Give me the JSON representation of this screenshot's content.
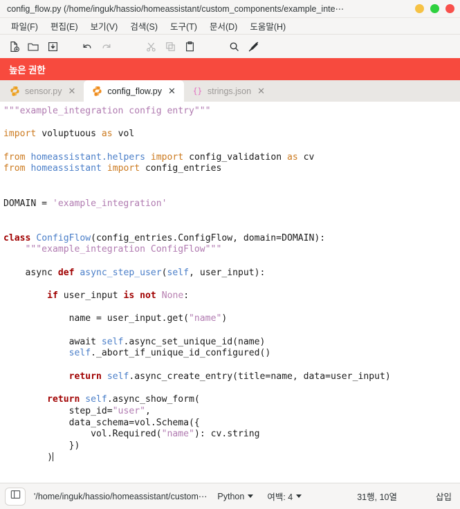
{
  "window": {
    "title": "config_flow.py (/home/inguk/hassio/homeassistant/custom_components/example_inte⋯",
    "buttons": [
      {
        "name": "minimize",
        "color": "#f6c244"
      },
      {
        "name": "maximize",
        "color": "#2fd13f"
      },
      {
        "name": "close",
        "color": "#f8504b"
      }
    ]
  },
  "menu": {
    "items": [
      {
        "label": "파일(F)"
      },
      {
        "label": "편집(E)"
      },
      {
        "label": "보기(V)"
      },
      {
        "label": "검색(S)"
      },
      {
        "label": "도구(T)"
      },
      {
        "label": "문서(D)"
      },
      {
        "label": "도움말(H)"
      }
    ]
  },
  "toolbar": {
    "items": [
      {
        "icon": "new-file-icon",
        "enabled": true
      },
      {
        "icon": "open-folder-icon",
        "enabled": true
      },
      {
        "icon": "save-icon",
        "enabled": true
      },
      {
        "icon": "undo-icon",
        "enabled": true
      },
      {
        "icon": "redo-icon",
        "enabled": false
      },
      {
        "icon": "cut-icon",
        "enabled": false
      },
      {
        "icon": "copy-icon",
        "enabled": false
      },
      {
        "icon": "paste-icon",
        "enabled": true
      },
      {
        "icon": "search-icon",
        "enabled": true
      },
      {
        "icon": "highlight-off-icon",
        "enabled": true
      }
    ]
  },
  "banner": {
    "text": "높은 권한",
    "color": "#f74a3e"
  },
  "tabs": [
    {
      "label": "sensor.py",
      "icon": "python-file-icon",
      "active": false,
      "close": "✕"
    },
    {
      "label": "config_flow.py",
      "icon": "python-file-icon",
      "active": true,
      "close": "✕"
    },
    {
      "label": "strings.json",
      "icon": "json-file-icon",
      "active": false,
      "close": "✕"
    }
  ],
  "editor": {
    "language": "Python",
    "lines": [
      [
        {
          "t": "\"\"\"example_integration config entry\"\"\"",
          "c": "str"
        }
      ],
      [],
      [
        {
          "t": "import",
          "c": "kw2"
        },
        {
          "t": " voluptuous ",
          "c": "plain"
        },
        {
          "t": "as",
          "c": "kw2"
        },
        {
          "t": " vol",
          "c": "plain"
        }
      ],
      [],
      [
        {
          "t": "from",
          "c": "kw2"
        },
        {
          "t": " ",
          "c": "plain"
        },
        {
          "t": "homeassistant.helpers",
          "c": "nm"
        },
        {
          "t": " ",
          "c": "plain"
        },
        {
          "t": "import",
          "c": "kw2"
        },
        {
          "t": " config_validation ",
          "c": "plain"
        },
        {
          "t": "as",
          "c": "kw2"
        },
        {
          "t": " cv",
          "c": "plain"
        }
      ],
      [
        {
          "t": "from",
          "c": "kw2"
        },
        {
          "t": " ",
          "c": "plain"
        },
        {
          "t": "homeassistant",
          "c": "nm"
        },
        {
          "t": " ",
          "c": "plain"
        },
        {
          "t": "import",
          "c": "kw2"
        },
        {
          "t": " config_entries",
          "c": "plain"
        }
      ],
      [],
      [],
      [
        {
          "t": "DOMAIN = ",
          "c": "plain"
        },
        {
          "t": "'example_integration'",
          "c": "str"
        }
      ],
      [],
      [],
      [
        {
          "t": "class",
          "c": "kw"
        },
        {
          "t": " ",
          "c": "plain"
        },
        {
          "t": "ConfigFlow",
          "c": "nm"
        },
        {
          "t": "(config_entries.ConfigFlow, domain=DOMAIN):",
          "c": "plain"
        }
      ],
      [
        {
          "t": "    \"\"\"example_integration ConfigFlow\"\"\"",
          "c": "str"
        }
      ],
      [],
      [
        {
          "t": "    async ",
          "c": "plain"
        },
        {
          "t": "def",
          "c": "kw"
        },
        {
          "t": " ",
          "c": "plain"
        },
        {
          "t": "async_step_user",
          "c": "nm"
        },
        {
          "t": "(",
          "c": "plain"
        },
        {
          "t": "self",
          "c": "nm"
        },
        {
          "t": ", user_input):",
          "c": "plain"
        }
      ],
      [],
      [
        {
          "t": "        ",
          "c": "plain"
        },
        {
          "t": "if",
          "c": "kw"
        },
        {
          "t": " user_input ",
          "c": "plain"
        },
        {
          "t": "is",
          "c": "kw"
        },
        {
          "t": " ",
          "c": "plain"
        },
        {
          "t": "not",
          "c": "kw"
        },
        {
          "t": " ",
          "c": "plain"
        },
        {
          "t": "None",
          "c": "none"
        },
        {
          "t": ":",
          "c": "plain"
        }
      ],
      [],
      [
        {
          "t": "            name = user_input.get(",
          "c": "plain"
        },
        {
          "t": "\"name\"",
          "c": "str"
        },
        {
          "t": ")",
          "c": "plain"
        }
      ],
      [],
      [
        {
          "t": "            await ",
          "c": "plain"
        },
        {
          "t": "self",
          "c": "nm"
        },
        {
          "t": ".async_set_unique_id(name)",
          "c": "plain"
        }
      ],
      [
        {
          "t": "            ",
          "c": "plain"
        },
        {
          "t": "self",
          "c": "nm"
        },
        {
          "t": "._abort_if_unique_id_configured()",
          "c": "plain"
        }
      ],
      [],
      [
        {
          "t": "            ",
          "c": "plain"
        },
        {
          "t": "return",
          "c": "kw"
        },
        {
          "t": " ",
          "c": "plain"
        },
        {
          "t": "self",
          "c": "nm"
        },
        {
          "t": ".async_create_entry(title=name, data=user_input)",
          "c": "plain"
        }
      ],
      [],
      [
        {
          "t": "        ",
          "c": "plain"
        },
        {
          "t": "return",
          "c": "kw"
        },
        {
          "t": " ",
          "c": "plain"
        },
        {
          "t": "self",
          "c": "nm"
        },
        {
          "t": ".async_show_form(",
          "c": "plain"
        }
      ],
      [
        {
          "t": "            step_id=",
          "c": "plain"
        },
        {
          "t": "\"user\"",
          "c": "str"
        },
        {
          "t": ",",
          "c": "plain"
        }
      ],
      [
        {
          "t": "            data_schema=vol.Schema({",
          "c": "plain"
        }
      ],
      [
        {
          "t": "                vol.Required(",
          "c": "plain"
        },
        {
          "t": "\"name\"",
          "c": "str"
        },
        {
          "t": "): cv.string",
          "c": "plain"
        }
      ],
      [
        {
          "t": "            })",
          "c": "plain"
        }
      ],
      [
        {
          "t": "        )",
          "c": "plain",
          "caret": true
        }
      ]
    ]
  },
  "statusbar": {
    "path": "'/home/inguk/hassio/homeassistant/custom⋯",
    "language": "Python",
    "indent": "여백: 4",
    "position": "31행, 10열",
    "mode": "삽입"
  }
}
